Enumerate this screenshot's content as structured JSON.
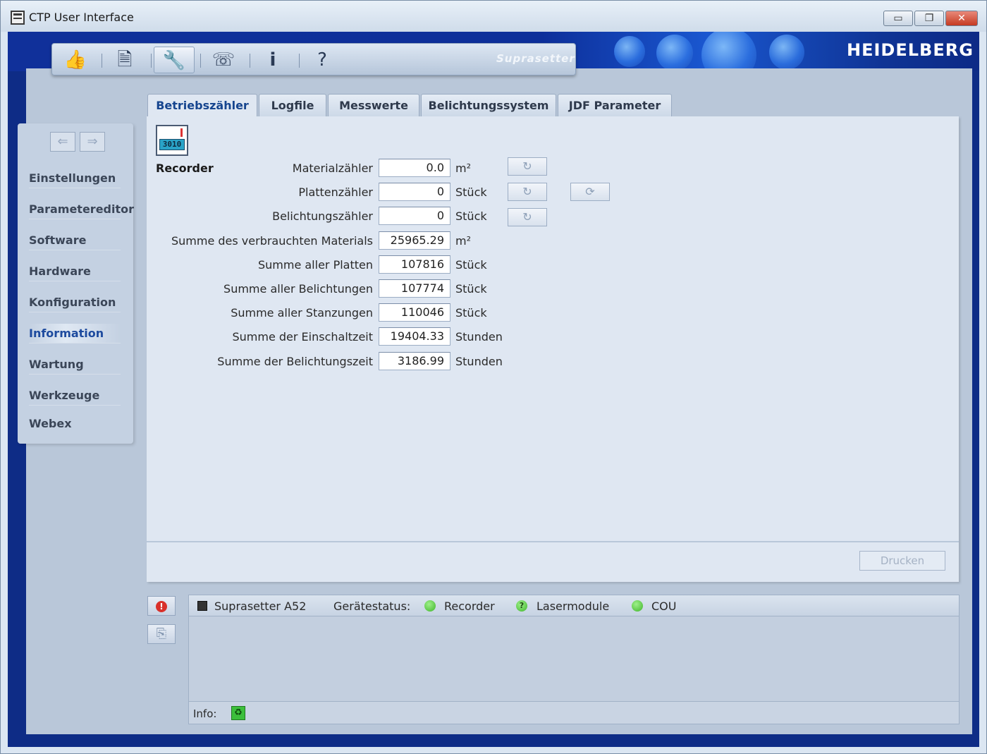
{
  "window": {
    "title": "CTP User Interface",
    "minimize_glyph": "▭",
    "maximize_glyph": "❐",
    "close_glyph": "✕"
  },
  "brand": {
    "logo": "HEIDELBERG",
    "product": "Suprasetter"
  },
  "toolbar": {
    "buttons": [
      {
        "name": "thumbs-up-icon",
        "glyph": "👍"
      },
      {
        "name": "document-icon",
        "glyph": "🗎"
      },
      {
        "name": "wrench-icon",
        "glyph": "🔧"
      },
      {
        "name": "phone-icon",
        "glyph": "☏"
      },
      {
        "name": "info-icon",
        "glyph": "i"
      },
      {
        "name": "help-icon",
        "glyph": "?"
      }
    ]
  },
  "sidebar": {
    "back_glyph": "⇐",
    "forward_glyph": "⇒",
    "items": [
      {
        "label": "Einstellungen"
      },
      {
        "label": "Parametereditor"
      },
      {
        "label": "Software"
      },
      {
        "label": "Hardware"
      },
      {
        "label": "Konfiguration"
      },
      {
        "label": "Information",
        "active": true
      },
      {
        "label": "Wartung"
      },
      {
        "label": "Werkzeuge"
      },
      {
        "label": "Webex"
      }
    ]
  },
  "tabs": [
    {
      "label": "Betriebszähler",
      "active": true
    },
    {
      "label": "Logfile"
    },
    {
      "label": "Messwerte"
    },
    {
      "label": "Belichtungssystem"
    },
    {
      "label": "JDF Parameter"
    }
  ],
  "recorder": {
    "icon_counter": "3010",
    "title": "Recorder",
    "reset_glyph": "↻",
    "reset_all_glyph": "⟳",
    "rows": [
      {
        "label": "Materialzähler",
        "value": "0.0",
        "unit": "m²"
      },
      {
        "label": "Plattenzähler",
        "value": "0",
        "unit": "Stück"
      },
      {
        "label": "Belichtungszähler",
        "value": "0",
        "unit": "Stück"
      },
      {
        "label": "Summe des verbrauchten Materials",
        "value": "25965.29",
        "unit": "m²"
      },
      {
        "label": "Summe aller Platten",
        "value": "107816",
        "unit": "Stück"
      },
      {
        "label": "Summe aller Belichtungen",
        "value": "107774",
        "unit": "Stück"
      },
      {
        "label": "Summe aller Stanzungen",
        "value": "110046",
        "unit": "Stück"
      },
      {
        "label": "Summe der Einschaltzeit",
        "value": "19404.33",
        "unit": "Stunden"
      },
      {
        "label": "Summe der Belichtungszeit",
        "value": "3186.99",
        "unit": "Stunden"
      }
    ]
  },
  "actions": {
    "print_label": "Drucken"
  },
  "side_buttons": {
    "error_glyph": "!",
    "export_glyph": "⎘"
  },
  "status": {
    "device": "Suprasetter A52",
    "label": "Gerätestatus:",
    "recorder": "Recorder",
    "laser": "Lasermodule",
    "laser_glyph": "?",
    "cou": "COU",
    "info_label": "Info:",
    "info_glyph": "♻"
  },
  "colors": {
    "frame_blue": "#0e2c86",
    "status_ok": "#3fb52a",
    "status_error": "#d9302a"
  }
}
